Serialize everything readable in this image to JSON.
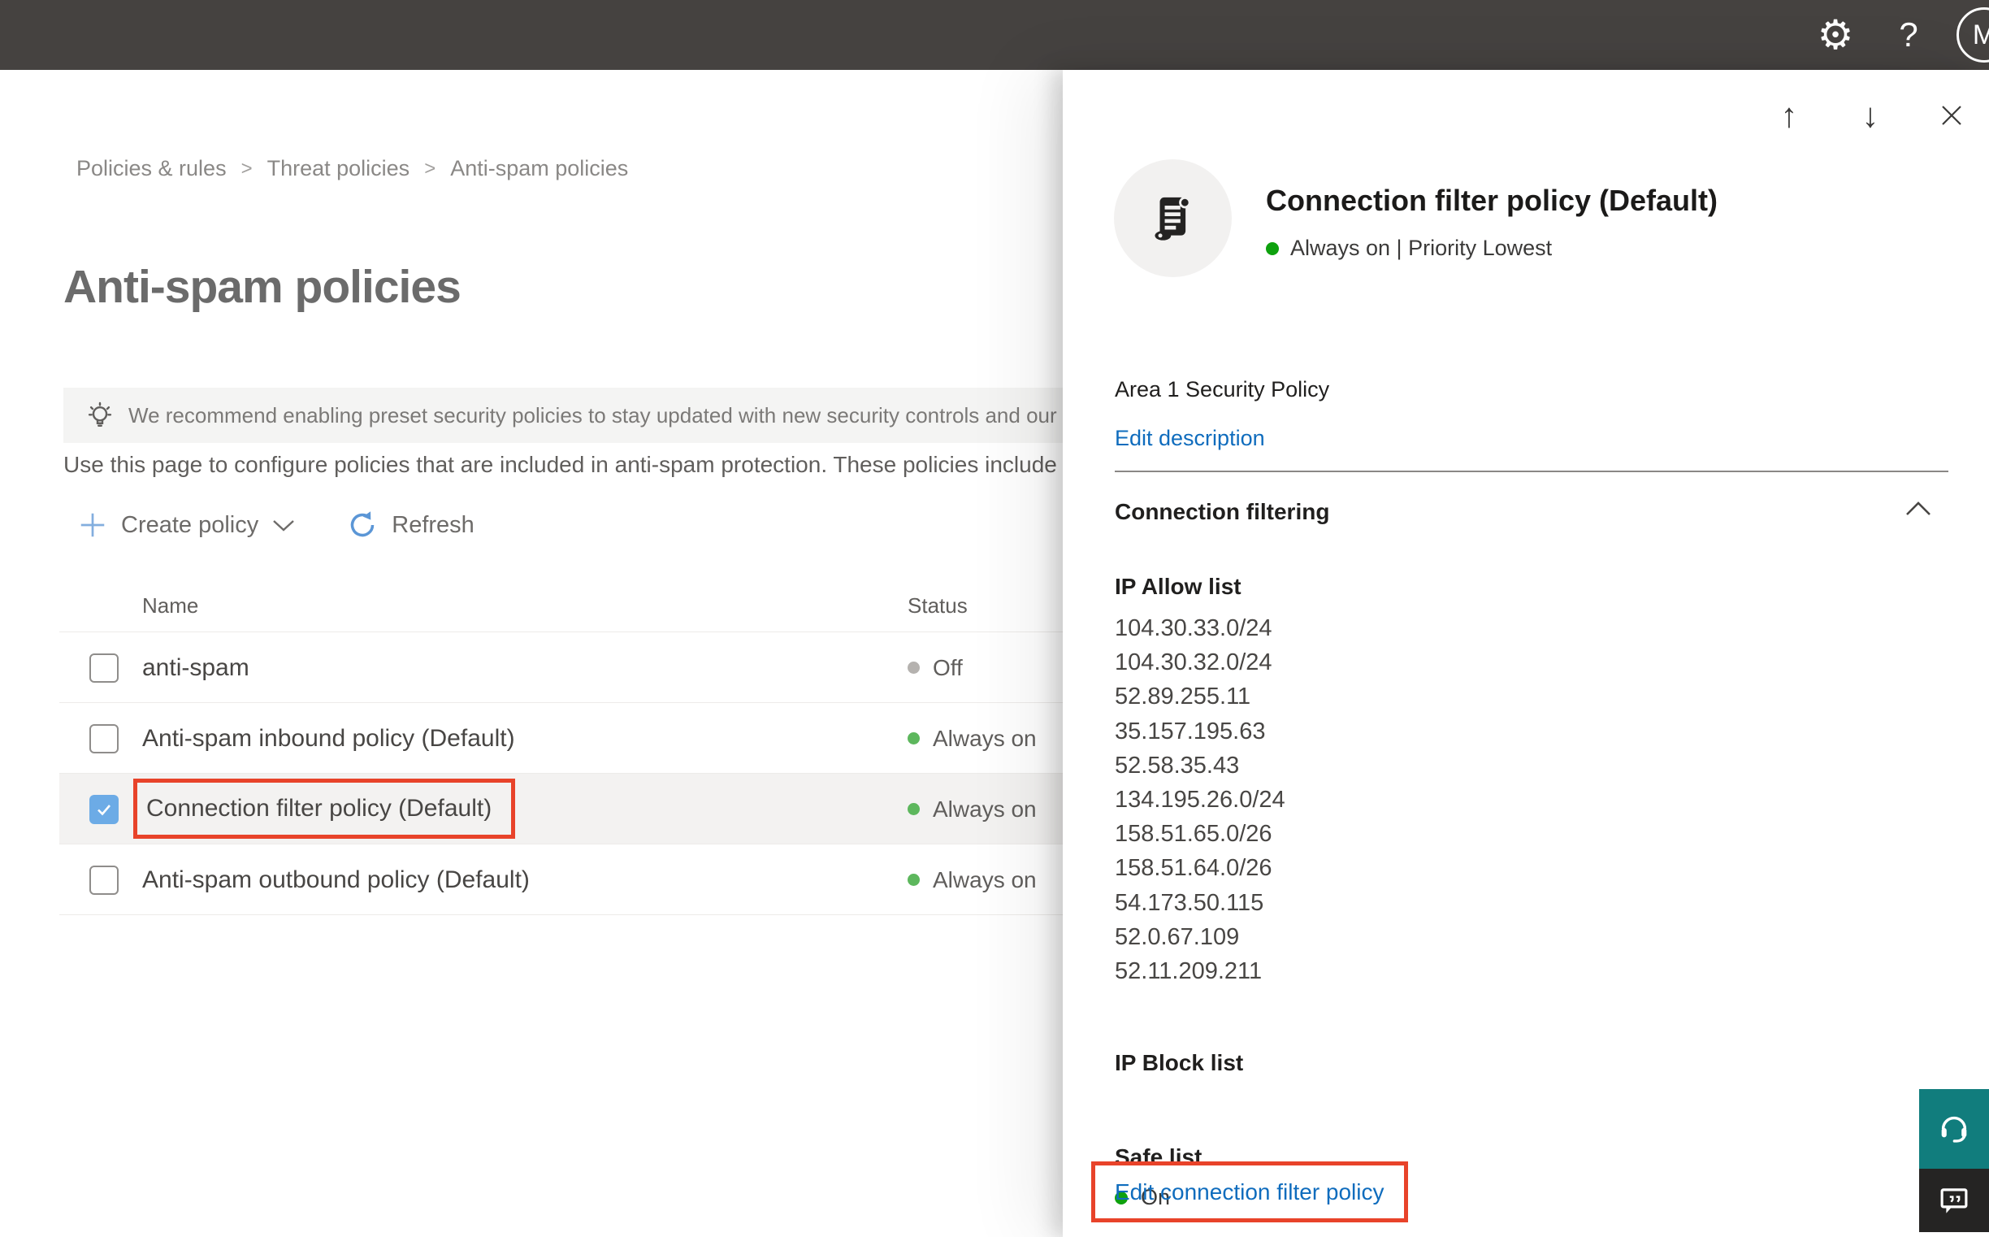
{
  "topbar": {
    "avatar_initial": "M"
  },
  "breadcrumb": {
    "items": [
      "Policies & rules",
      "Threat policies",
      "Anti-spam policies"
    ],
    "separator": ">"
  },
  "page": {
    "title": "Anti-spam policies",
    "banner_text": "We recommend enabling preset security policies to stay updated with new security controls and our recomme",
    "intro_text": "Use this page to configure policies that are included in anti-spam protection. These policies include"
  },
  "toolbar": {
    "create_policy_label": "Create policy",
    "refresh_label": "Refresh"
  },
  "policy_table": {
    "columns": {
      "name": "Name",
      "status": "Status"
    },
    "rows": [
      {
        "name": "anti-spam",
        "status": "Off",
        "state": "off",
        "checked": false,
        "selected": false
      },
      {
        "name": "Anti-spam inbound policy (Default)",
        "status": "Always on",
        "state": "on",
        "checked": false,
        "selected": false
      },
      {
        "name": "Connection filter policy (Default)",
        "status": "Always on",
        "state": "on",
        "checked": true,
        "selected": true
      },
      {
        "name": "Anti-spam outbound policy (Default)",
        "status": "Always on",
        "state": "on",
        "checked": false,
        "selected": false
      }
    ]
  },
  "flyout": {
    "title": "Connection filter policy (Default)",
    "status_line": "Always on | Priority Lowest",
    "description": "Area 1 Security Policy",
    "edit_description_label": "Edit description",
    "section_title": "Connection filtering",
    "ip_allow": {
      "label": "IP Allow list",
      "ips": [
        "104.30.33.0/24",
        "104.30.32.0/24",
        "52.89.255.11",
        "35.157.195.63",
        "52.58.35.43",
        "134.195.26.0/24",
        "158.51.65.0/26",
        "158.51.64.0/26",
        "54.173.50.115",
        "52.0.67.109",
        "52.11.209.211"
      ]
    },
    "ip_block_label": "IP Block list",
    "safe_list_label": "Safe list",
    "safe_list_value": "On",
    "edit_link_label": "Edit connection filter policy"
  },
  "colors": {
    "topbar_bg": "#454240",
    "accent_blue": "#0f6cbd",
    "selection_red": "#e8432a",
    "status_on_green_flyout": "#0ea10e",
    "status_on_green_table": "#5db75d",
    "status_off_gray": "#b5b2af",
    "checkbox_blue": "#6cabe6",
    "support_teal": "#117d7d",
    "feedback_dark": "#252423"
  }
}
